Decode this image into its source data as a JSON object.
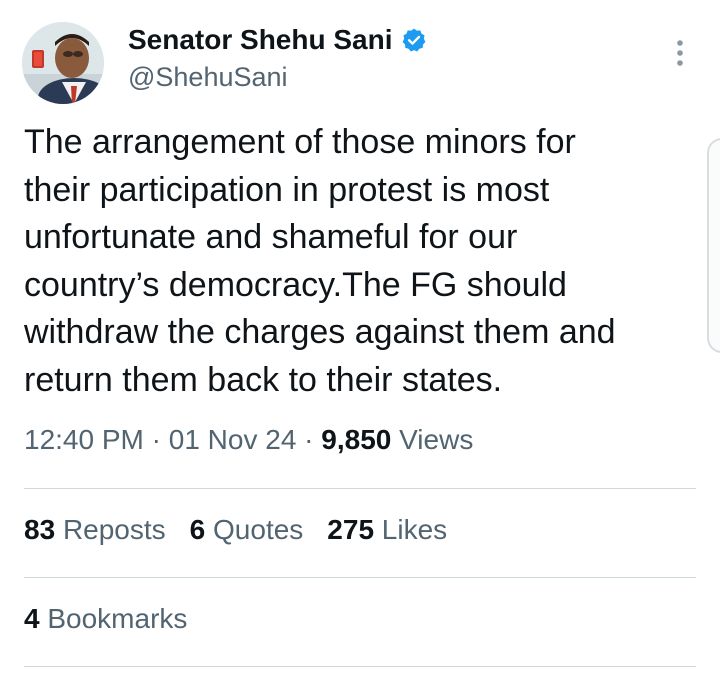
{
  "author": {
    "display_name": "Senator Shehu Sani",
    "handle": "@ShehuSani",
    "verified_color": "#1d9bf0"
  },
  "icons": {
    "verified": "verified-badge-icon",
    "more": "more-vertical-icon"
  },
  "tweet": {
    "text": "The arrangement of those minors for\ntheir participation in protest is most\nunfortunate and shameful for our\ncountry’s democracy.The FG should\nwithdraw the charges against them and\nreturn them back to their states.",
    "time": "12:40 PM",
    "date": "01 Nov 24",
    "views_count": "9,850",
    "views_label": "Views"
  },
  "stats": {
    "reposts_count": "83",
    "reposts_label": "Reposts",
    "quotes_count": "6",
    "quotes_label": "Quotes",
    "likes_count": "275",
    "likes_label": "Likes",
    "bookmarks_count": "4",
    "bookmarks_label": "Bookmarks"
  }
}
